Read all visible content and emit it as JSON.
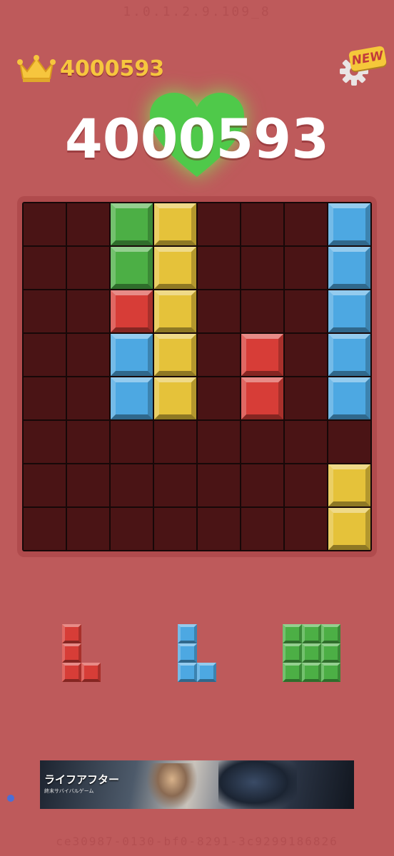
{
  "overlay_top_text": "1.0.1.2.9.109_8",
  "overlay_bottom_text": "ce30987-0130-bf0-8291-3c9299186826",
  "header": {
    "best_score": "4000593",
    "crown_icon": "crown-icon",
    "settings_icon": "gear-icon",
    "new_badge": "NEW"
  },
  "score": {
    "current": "4000593",
    "heart_icon": "heart-icon",
    "heart_color": "#4fc94a"
  },
  "colors": {
    "board_bg": "#170808",
    "empty_cell": "#4a1415",
    "green": "#4caf45",
    "yellow": "#e5c23a",
    "red": "#d73d37",
    "blue": "#4da8e2",
    "page_bg": "#be5a5b"
  },
  "board": {
    "rows": 8,
    "cols": 8,
    "cells": [
      [
        ".",
        ".",
        "G",
        "Y",
        ".",
        ".",
        ".",
        "B"
      ],
      [
        ".",
        ".",
        "G",
        "Y",
        ".",
        ".",
        ".",
        "B"
      ],
      [
        ".",
        ".",
        "R",
        "Y",
        ".",
        ".",
        ".",
        "B"
      ],
      [
        ".",
        ".",
        "B",
        "Y",
        ".",
        "R",
        ".",
        "B"
      ],
      [
        ".",
        ".",
        "B",
        "Y",
        ".",
        "R",
        ".",
        "B"
      ],
      [
        ".",
        ".",
        ".",
        ".",
        ".",
        ".",
        ".",
        "."
      ],
      [
        ".",
        ".",
        ".",
        ".",
        ".",
        ".",
        ".",
        "Y"
      ],
      [
        ".",
        ".",
        ".",
        ".",
        ".",
        ".",
        ".",
        "Y"
      ]
    ]
  },
  "tray": [
    {
      "color": "R",
      "shape": [
        [
          1,
          0
        ],
        [
          1,
          0
        ],
        [
          1,
          1
        ]
      ]
    },
    {
      "color": "B",
      "shape": [
        [
          1,
          0
        ],
        [
          1,
          0
        ],
        [
          1,
          1
        ]
      ]
    },
    {
      "color": "G",
      "shape": [
        [
          1,
          1,
          1
        ],
        [
          1,
          1,
          1
        ],
        [
          1,
          1,
          1
        ]
      ]
    }
  ],
  "ad": {
    "title": "ライフアフター",
    "subtitle": "終末サバイバルゲーム"
  }
}
